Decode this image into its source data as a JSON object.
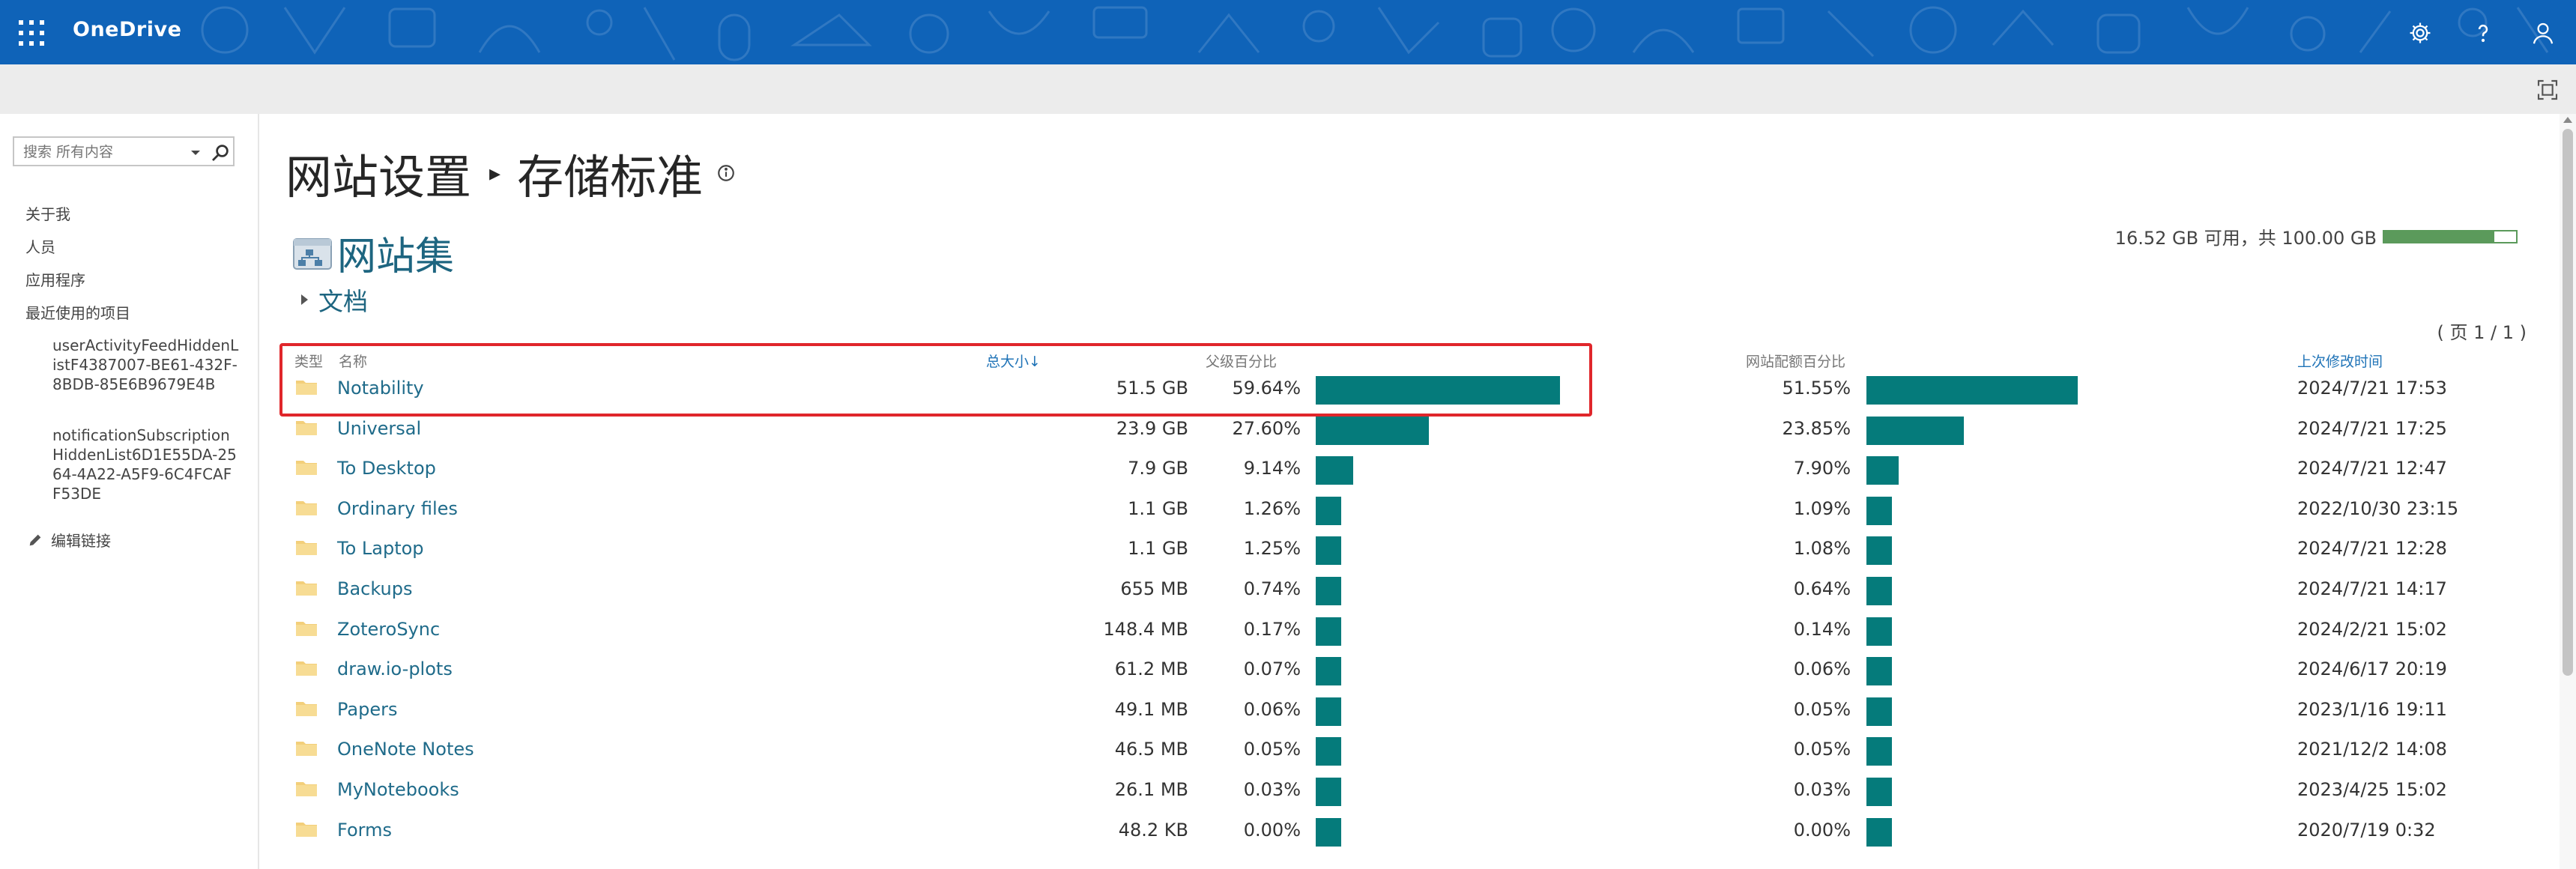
{
  "suitebar": {
    "brand": "OneDrive",
    "icons": [
      "waffle-icon",
      "gear-icon",
      "help-icon",
      "person-icon"
    ]
  },
  "leftnav": {
    "search_placeholder": "搜索 所有内容",
    "links": [
      "关于我",
      "人员",
      "应用程序",
      "最近使用的项目"
    ],
    "recent": [
      "userActivityFeedHiddenListF4387007-BE61-432F-8BDB-85E6B9679E4B",
      "notificationSubscriptionHiddenList6D1E55DA-2564-4A22-A5F9-6C4FCAFF53DE"
    ],
    "edit_links": "编辑链接"
  },
  "page": {
    "title_part1": "网站设置",
    "title_part2": "存储标准",
    "site_collection": "网站集",
    "documents": "文档",
    "quota_text": "16.52 GB 可用，共 100.00 GB",
    "quota_used_fraction": 0.8348,
    "pager": "( 页 1 / 1 )"
  },
  "table": {
    "headers": {
      "type": "类型",
      "name": "名称",
      "total_size": "总大小",
      "parent_percent": "父级百分比",
      "site_quota_percent": "网站配额百分比",
      "last_modified": "上次修改时间"
    },
    "rows": [
      {
        "name": "Notability",
        "size": "51.5 GB",
        "parent_pct": "59.64%",
        "parent_val": 59.64,
        "quota_pct": "51.55%",
        "quota_val": 51.55,
        "modified": "2024/7/21 17:53"
      },
      {
        "name": "Universal",
        "size": "23.9 GB",
        "parent_pct": "27.60%",
        "parent_val": 27.6,
        "quota_pct": "23.85%",
        "quota_val": 23.85,
        "modified": "2024/7/21 17:25"
      },
      {
        "name": "To Desktop",
        "size": "7.9 GB",
        "parent_pct": "9.14%",
        "parent_val": 9.14,
        "quota_pct": "7.90%",
        "quota_val": 7.9,
        "modified": "2024/7/21 12:47"
      },
      {
        "name": "Ordinary files",
        "size": "1.1 GB",
        "parent_pct": "1.26%",
        "parent_val": 1.26,
        "quota_pct": "1.09%",
        "quota_val": 1.09,
        "modified": "2022/10/30 23:15"
      },
      {
        "name": "To Laptop",
        "size": "1.1 GB",
        "parent_pct": "1.25%",
        "parent_val": 1.25,
        "quota_pct": "1.08%",
        "quota_val": 1.08,
        "modified": "2024/7/21 12:28"
      },
      {
        "name": "Backups",
        "size": "655 MB",
        "parent_pct": "0.74%",
        "parent_val": 0.74,
        "quota_pct": "0.64%",
        "quota_val": 0.64,
        "modified": "2024/7/21 14:17"
      },
      {
        "name": "ZoteroSync",
        "size": "148.4 MB",
        "parent_pct": "0.17%",
        "parent_val": 0.17,
        "quota_pct": "0.14%",
        "quota_val": 0.14,
        "modified": "2024/2/21 15:02"
      },
      {
        "name": "draw.io-plots",
        "size": "61.2 MB",
        "parent_pct": "0.07%",
        "parent_val": 0.07,
        "quota_pct": "0.06%",
        "quota_val": 0.06,
        "modified": "2024/6/17 20:19"
      },
      {
        "name": "Papers",
        "size": "49.1 MB",
        "parent_pct": "0.06%",
        "parent_val": 0.06,
        "quota_pct": "0.05%",
        "quota_val": 0.05,
        "modified": "2023/1/16 19:11"
      },
      {
        "name": "OneNote Notes",
        "size": "46.5 MB",
        "parent_pct": "0.05%",
        "parent_val": 0.05,
        "quota_pct": "0.05%",
        "quota_val": 0.05,
        "modified": "2021/12/2 14:08"
      },
      {
        "name": "MyNotebooks",
        "size": "26.1 MB",
        "parent_pct": "0.03%",
        "parent_val": 0.03,
        "quota_pct": "0.03%",
        "quota_val": 0.03,
        "modified": "2023/4/25 15:02"
      },
      {
        "name": "Forms",
        "size": "48.2 KB",
        "parent_pct": "0.00%",
        "parent_val": 0.0,
        "quota_pct": "0.00%",
        "quota_val": 0.0,
        "modified": "2020/7/19 0:32"
      }
    ]
  },
  "colors": {
    "suitebar": "#0f63b8",
    "bar": "#057b7b",
    "link": "#1f6b8a",
    "highlight": "#e0262b",
    "quota_fill": "#5b9a5b"
  }
}
